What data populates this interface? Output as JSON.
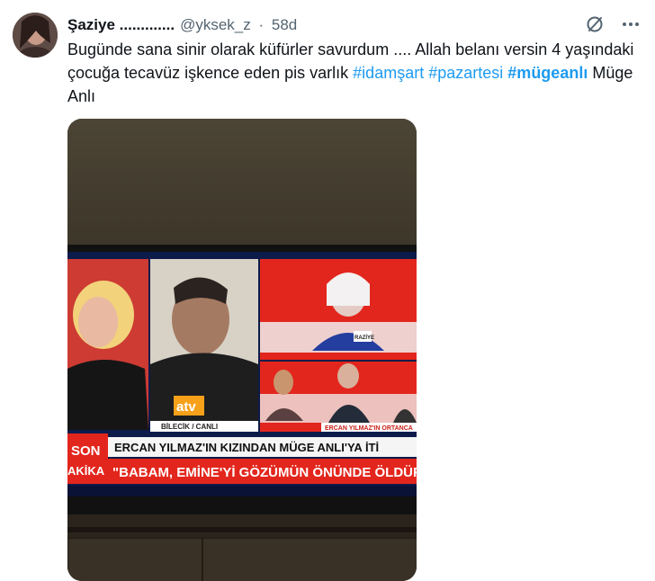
{
  "tweet": {
    "author_name": "Şaziye .............",
    "handle": "@yksek_z",
    "separator": "·",
    "time": "58d",
    "text_plain": "Bugünde sana sinir olarak küfürler savurdum .... Allah belanı versin 4 yaşındaki çocuğa tecavüz işkence eden pis varlık ",
    "hashtags": [
      "#idamşart",
      "#pazartesi",
      "#mügeanlı"
    ],
    "text_tail": " Müge Anlı"
  },
  "tv": {
    "left_badge_top": "SON",
    "left_badge_bottom": "AKİKA",
    "location": "BİLECİK / CANLI",
    "network_logo": "atv",
    "name_tag": "RAZİYE",
    "side_caption": "ERCAN YILMAZ'IN ORTANCA",
    "ticker_line1": "ERCAN YILMAZ'IN KIZINDAN MÜGE ANLI'YA İTİ",
    "ticker_line2": "\"BABAM, EMİNE'Yİ GÖZÜMÜN ÖNÜNDE ÖLDÜR"
  },
  "icons": {
    "grok": "slash-circle-icon",
    "more": "more-icon"
  },
  "colors": {
    "link": "#1d9bf0",
    "secondary": "#536471",
    "tv_red": "#e3261d"
  }
}
